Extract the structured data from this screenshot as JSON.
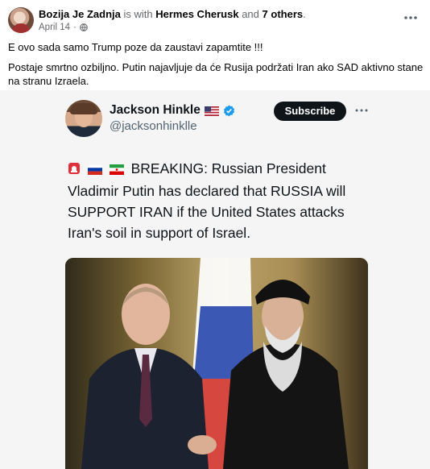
{
  "post": {
    "author": "Bozija Je Zadnja",
    "with_text": "is with",
    "tagged": "Hermes Cherusk",
    "and_text": "and",
    "others": "7 others",
    "period": ".",
    "date": "April 14",
    "dot": "·",
    "text_line1": "E ovo sada samo Trump poze da zaustavi zapamtite !!!",
    "text_line2": "Postaje smrtno ozbiljno.  Putin najavljuje da će Rusija podržati Iran ako SAD aktivno stane na stranu Izraela."
  },
  "tweet": {
    "name": "Jackson Hinkle",
    "handle": "@jacksonhinklle",
    "subscribe_label": "Subscribe",
    "body": "BREAKING: Russian President Vladimir Putin has declared that RUSSIA will SUPPORT IRAN if the United States attacks Iran's soil in support of Israel."
  },
  "icons": {
    "post_more": "more-horizontal-icon",
    "globe": "globe-icon",
    "verified": "verified-badge-icon",
    "flag": "us-flag-icon"
  },
  "colors": {
    "subscribe_bg": "#0f1419",
    "verified": "#1d9bf0",
    "muted": "#65676b"
  }
}
